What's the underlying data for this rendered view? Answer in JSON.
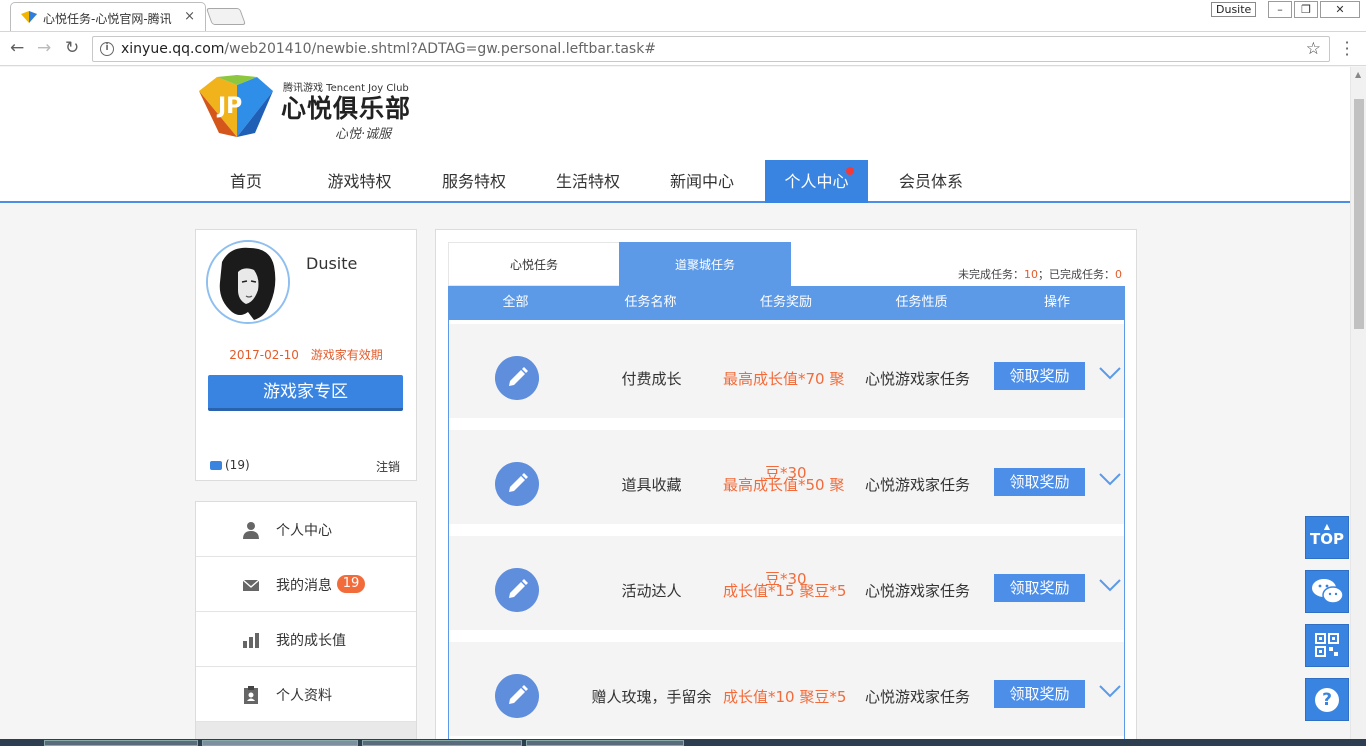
{
  "browser": {
    "tab_title": "心悦任务-心悦官网-腾讯",
    "tab_close": "×",
    "window_user": "Dusite",
    "win_min": "–",
    "win_restore": "❐",
    "win_close": "✕",
    "back": "←",
    "forward": "→",
    "reload": "↻",
    "url_host": "xinyue.qq.com",
    "url_path": "/web201410/newbie.shtml?ADTAG=gw.personal.leftbar.task#",
    "info_icon": "i",
    "star": "☆"
  },
  "brand": {
    "small": "腾讯游戏 Tencent Joy Club",
    "name": "心悦俱乐部",
    "slogan": "心悦·诚服"
  },
  "nav": {
    "items": [
      "首页",
      "游戏特权",
      "服务特权",
      "生活特权",
      "新闻中心",
      "个人中心",
      "会员体系"
    ],
    "active_index": 5
  },
  "profile": {
    "username": "Dusite",
    "expire_date": "2017-02-10",
    "expire_label": "游戏家有效期",
    "zone_button": "游戏家专区",
    "message_count": "(19)",
    "logout": "注销"
  },
  "sidemenu": {
    "items": [
      {
        "label": "个人中心",
        "icon": "user-icon"
      },
      {
        "label": "我的消息",
        "icon": "envelope-icon",
        "badge": "19"
      },
      {
        "label": "我的成长值",
        "icon": "bar-chart-icon"
      },
      {
        "label": "个人资料",
        "icon": "clipboard-icon"
      }
    ]
  },
  "tasks": {
    "tabs": [
      "心悦任务",
      "道聚城任务"
    ],
    "active_tab": 1,
    "stats": {
      "unfinished_label": "未完成任务：",
      "unfinished": "10",
      "sep": "；",
      "finished_label": "已完成任务：",
      "finished": "0"
    },
    "columns": [
      "全部",
      "任务名称",
      "任务奖励",
      "任务性质",
      "操作"
    ],
    "rows": [
      {
        "name": "付费成长",
        "reward": "最高成长值*70 聚",
        "overlap": "",
        "nature": "心悦游戏家任务",
        "action": "领取奖励"
      },
      {
        "name": "道具收藏",
        "reward": "最高成长值*50 聚",
        "overlap": "豆*30",
        "nature": "心悦游戏家任务",
        "action": "领取奖励"
      },
      {
        "name": "活动达人",
        "reward": "成长值*15 聚豆*5",
        "overlap": "豆*30",
        "nature": "心悦游戏家任务",
        "action": "领取奖励"
      },
      {
        "name": "赠人玫瑰，手留余",
        "reward": "成长值*10 聚豆*5",
        "overlap": "",
        "nature": "心悦游戏家任务",
        "action": "领取奖励"
      }
    ]
  },
  "float_tools": {
    "top_label": "TOP",
    "help": "?"
  },
  "colors": {
    "brand_blue": "#3a84e1",
    "table_blue": "#5c9ae8",
    "accent_orange": "#f26b3a"
  }
}
